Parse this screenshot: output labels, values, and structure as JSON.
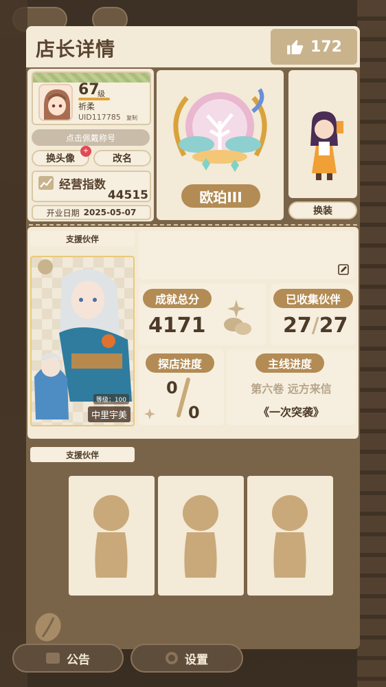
{
  "header": {
    "title": "店长详情",
    "likes": "172"
  },
  "profile": {
    "level": "67",
    "level_unit": "级",
    "name": "祈柔",
    "uid": "UID117785",
    "copy_label": "复制",
    "badge_btn": "点击佩戴称号",
    "change_avatar": "换头像",
    "notification": "+",
    "rename": "改名",
    "biz_label": "经营指数",
    "biz_value": "44515",
    "open_date_label": "开业日期",
    "open_date": "2025-05-07"
  },
  "rank": {
    "label": "欧珀III"
  },
  "character": {
    "outfit_btn": "换装"
  },
  "support": {
    "tag": "支援伙伴",
    "partner_level": "等级：100",
    "partner_name": "中里宇美"
  },
  "stats": {
    "achievement_label": "成就总分",
    "achievement_value": "4171",
    "collected_label": "已收集伙伴",
    "collected_value": "27",
    "collected_total": "27",
    "explore_label": "探店进度",
    "explore_value": "0",
    "explore_total": "0",
    "main_label": "主线进度",
    "main_chapter": "第六卷 远方来信",
    "main_title": "《一次突袭》"
  },
  "support2": {
    "tag": "支援伙伴"
  },
  "bottom": {
    "notice": "公告",
    "settings": "设置"
  },
  "colors": {
    "accent": "#b38b54",
    "panel": "#7a6449",
    "card": "#f3ead7"
  }
}
